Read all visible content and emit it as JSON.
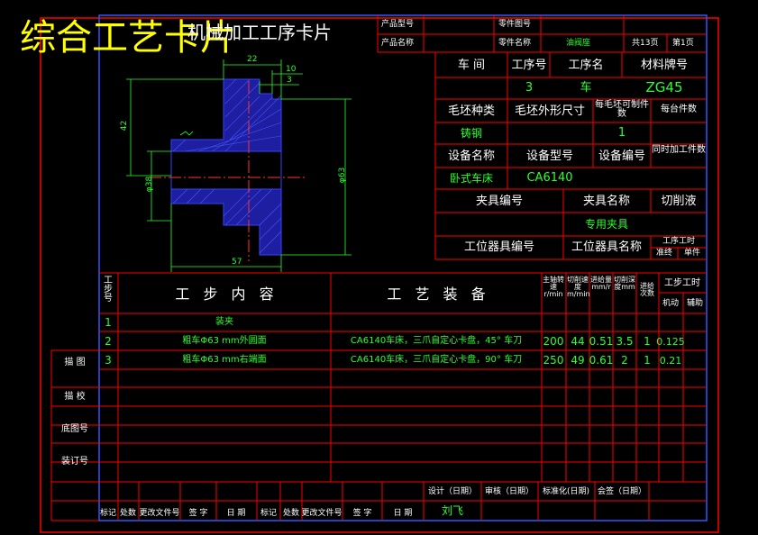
{
  "header": {
    "overlay_title": "综合工艺卡片",
    "card_title": "机械加工工序卡片",
    "product_model_label": "产品型号",
    "product_name_label": "产品名称",
    "part_no_label": "零件图号",
    "part_name_label": "零件名称",
    "part_name_value": "油阀座",
    "total_pages": "共13页",
    "page_no": "第1页"
  },
  "info": {
    "workshop_label": "车  间",
    "op_no_label": "工序号",
    "op_name_label": "工序名",
    "material_label": "材料牌号",
    "op_no_value": "3",
    "op_name_value": "车",
    "material_value": "ZG45",
    "blank_type_label": "毛坯种类",
    "blank_size_label": "毛坯外形尺寸",
    "pieces_per_blank_label": "每毛坯可制件数",
    "pieces_per_unit_label": "每台件数",
    "blank_type_value": "铸钢",
    "pieces_per_blank_value": "1",
    "equip_name_label": "设备名称",
    "equip_model_label": "设备型号",
    "equip_no_label": "设备编号",
    "simul_parts_label": "同时加工件数",
    "equip_name_value": "卧式车床",
    "equip_model_value": "CA6140",
    "fixture_no_label": "夹具编号",
    "fixture_name_label": "夹具名称",
    "coolant_label": "切削液",
    "fixture_name_value": "专用夹具",
    "station_tool_no_label": "工位器具编号",
    "station_tool_name_label": "工位器具名称",
    "op_time_label": "工序工时",
    "prep_label": "准终",
    "unit_label": "单件"
  },
  "drawing": {
    "dim_22": "22",
    "dim_10": "10",
    "dim_3": "3",
    "dim_42": "42",
    "dim_phi38": "φ38",
    "dim_phi63": "φ63",
    "dim_57": "57"
  },
  "steps_header": {
    "step_no": "工步号",
    "step_content": "工 步 内 容",
    "equipment": "工 艺 装 备",
    "spindle": "主轴转速r/min",
    "speed": "切削速度m/min",
    "feed": "进给量mm/r",
    "depth": "切削深度mm",
    "passes": "进给次数",
    "time": "工步工时",
    "machine_time": "机动",
    "aux_time": "辅助"
  },
  "steps": [
    {
      "no": "1",
      "content": "装夹",
      "equip": "",
      "spindle": "",
      "speed": "",
      "feed": "",
      "depth": "",
      "passes": "",
      "time": ""
    },
    {
      "no": "2",
      "content": "粗车Φ63 mm外圆面",
      "equip": "CA6140车床，三爪自定心卡盘，45° 车刀",
      "spindle": "200",
      "speed": "44",
      "feed": "0.51",
      "depth": "3.5",
      "passes": "1",
      "time": "0.125"
    },
    {
      "no": "3",
      "content": "粗车Φ63 mm右端面",
      "equip": "CA6140车床，三爪自定心卡盘，90° 车刀",
      "spindle": "250",
      "speed": "49",
      "feed": "0.61",
      "depth": "2",
      "passes": "1",
      "time": "0.21"
    }
  ],
  "side": {
    "trace": "描  图",
    "check": "描  校",
    "base_no": "底图号",
    "binding_no": "装订号"
  },
  "footer": {
    "design": "设计（日期）",
    "review": "审核（日期）",
    "standard": "标准化(日期)",
    "sign": "会签（日期）",
    "designer": "刘飞",
    "mark": "标记",
    "count": "处数",
    "change_doc": "更改文件号",
    "signature": "签  字",
    "date": "日  期"
  }
}
